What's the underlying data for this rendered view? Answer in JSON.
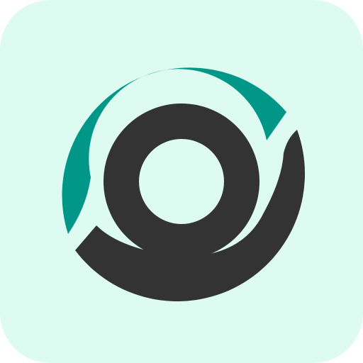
{
  "icon": {
    "name": "app-logo-icon",
    "colors": {
      "background": "#DDFBF0",
      "accent": "#009688",
      "dark": "#333333"
    }
  }
}
